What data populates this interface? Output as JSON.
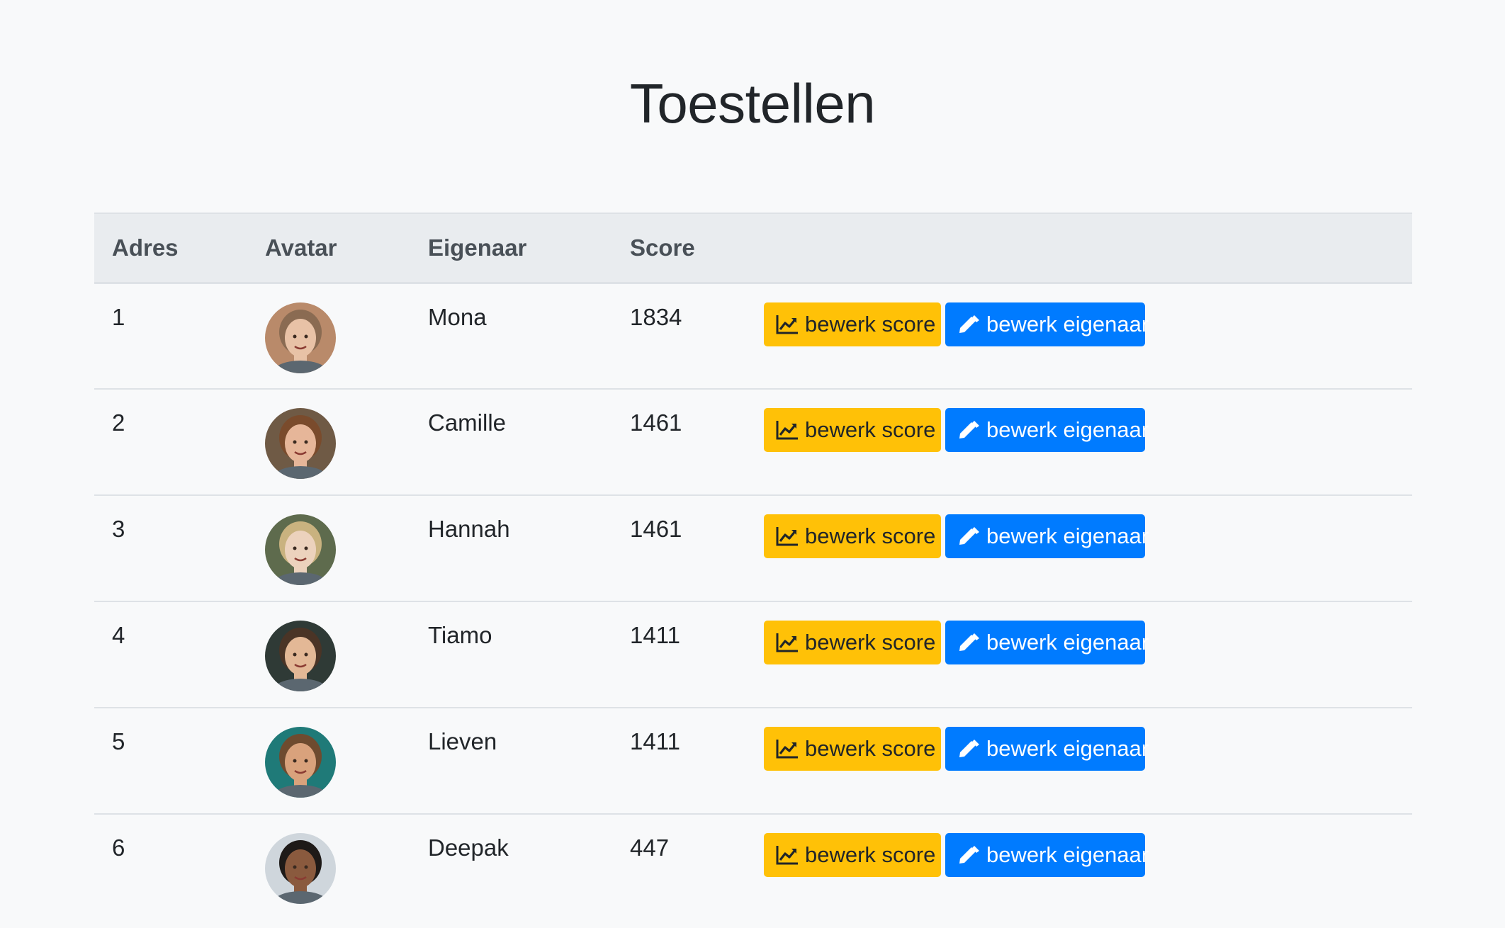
{
  "page": {
    "title": "Toestellen"
  },
  "table": {
    "columns": [
      "Adres",
      "Avatar",
      "Eigenaar",
      "Score",
      ""
    ],
    "rows": [
      {
        "address": "1",
        "owner": "Mona",
        "score": "1834",
        "avatar_bg": "#b98a6a",
        "avatar_skin": "#e8c2a6",
        "avatar_hair": "#8a6b52"
      },
      {
        "address": "2",
        "owner": "Camille",
        "score": "1461",
        "avatar_bg": "#6f5a45",
        "avatar_skin": "#e6b699",
        "avatar_hair": "#7a4b2c"
      },
      {
        "address": "3",
        "owner": "Hannah",
        "score": "1461",
        "avatar_bg": "#5e6b4d",
        "avatar_skin": "#ecd2bd",
        "avatar_hair": "#c9b27f"
      },
      {
        "address": "4",
        "owner": "Tiamo",
        "score": "1411",
        "avatar_bg": "#2f3a36",
        "avatar_skin": "#e3b896",
        "avatar_hair": "#4a3426"
      },
      {
        "address": "5",
        "owner": "Lieven",
        "score": "1411",
        "avatar_bg": "#1f7a78",
        "avatar_skin": "#d9a27c",
        "avatar_hair": "#6e4b2f"
      },
      {
        "address": "6",
        "owner": "Deepak",
        "score": "447",
        "avatar_bg": "#cfd6dc",
        "avatar_skin": "#8a5a3e",
        "avatar_hair": "#1e1a18"
      }
    ],
    "actions": {
      "edit_score_label": "bewerk score",
      "edit_owner_label": "bewerk eigenaar"
    }
  },
  "colors": {
    "score_button": "#ffc107",
    "owner_button": "#007bff",
    "header_bg": "#e9ecef",
    "page_bg": "#f8f9fa"
  },
  "icons": {
    "score_button_icon": "line-chart-icon",
    "owner_button_icon": "pencil-icon"
  }
}
